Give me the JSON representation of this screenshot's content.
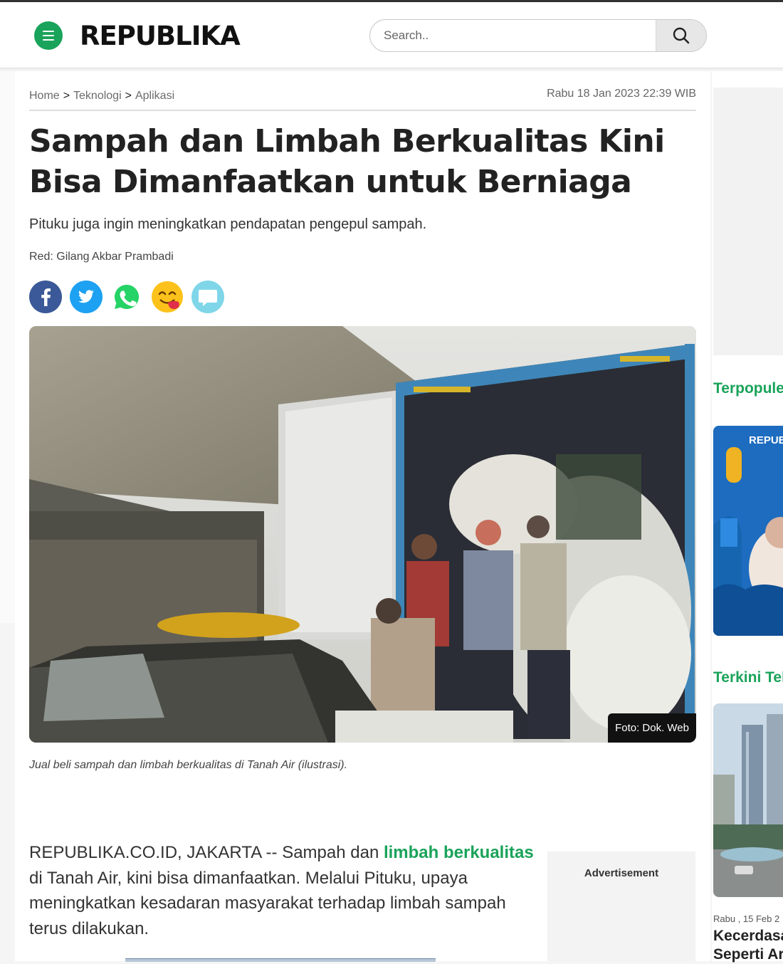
{
  "header": {
    "logo": "REPUBLIKA",
    "search_placeholder": "Search.."
  },
  "breadcrumb": {
    "items": [
      "Home",
      "Teknologi",
      "Aplikasi"
    ],
    "separator": ">"
  },
  "article": {
    "date": "Rabu 18 Jan 2023 22:39 WIB",
    "title": "Sampah dan Limbah Berkualitas Kini Bisa Dimanfaatkan untuk Berniaga",
    "subtitle": "Pituku juga ingin meningkatkan pendapatan pengepul sampah.",
    "editor": "Red: Gilang Akbar Prambadi",
    "share_icons": [
      "facebook-icon",
      "twitter-icon",
      "whatsapp-icon",
      "emoji-reaction-icon",
      "comment-icon"
    ],
    "photo_credit": "Foto: Dok. Web",
    "photo_caption": "Jual beli sampah dan limbah berkualitas di Tanah Air (ilustrasi).",
    "body_p1_before": "REPUBLIKA.CO.ID, JAKARTA -- Sampah dan ",
    "body_p1_link": "limbah berkualitas",
    "body_p1_after": " di Tanah Air, kini bisa dimanfaatkan. Melalui Pituku, upaya meningkatkan kesadaran masyarakat terhadap limbah sampah terus dilakukan."
  },
  "ad": {
    "label": "Advertisement"
  },
  "sidebar": {
    "popular_heading": "Terpopule",
    "popular_thumb_text": "REPUB",
    "latest_heading": "Terkini Tek",
    "latest_date": "Rabu , 15 Feb 2",
    "latest_title": "Kecerdasa Seperti Ar"
  },
  "colors": {
    "brand_green": "#1aa35a",
    "facebook": "#3b5998",
    "twitter": "#1da1f2",
    "whatsapp": "#25d366",
    "comment": "#7fd6e8"
  }
}
